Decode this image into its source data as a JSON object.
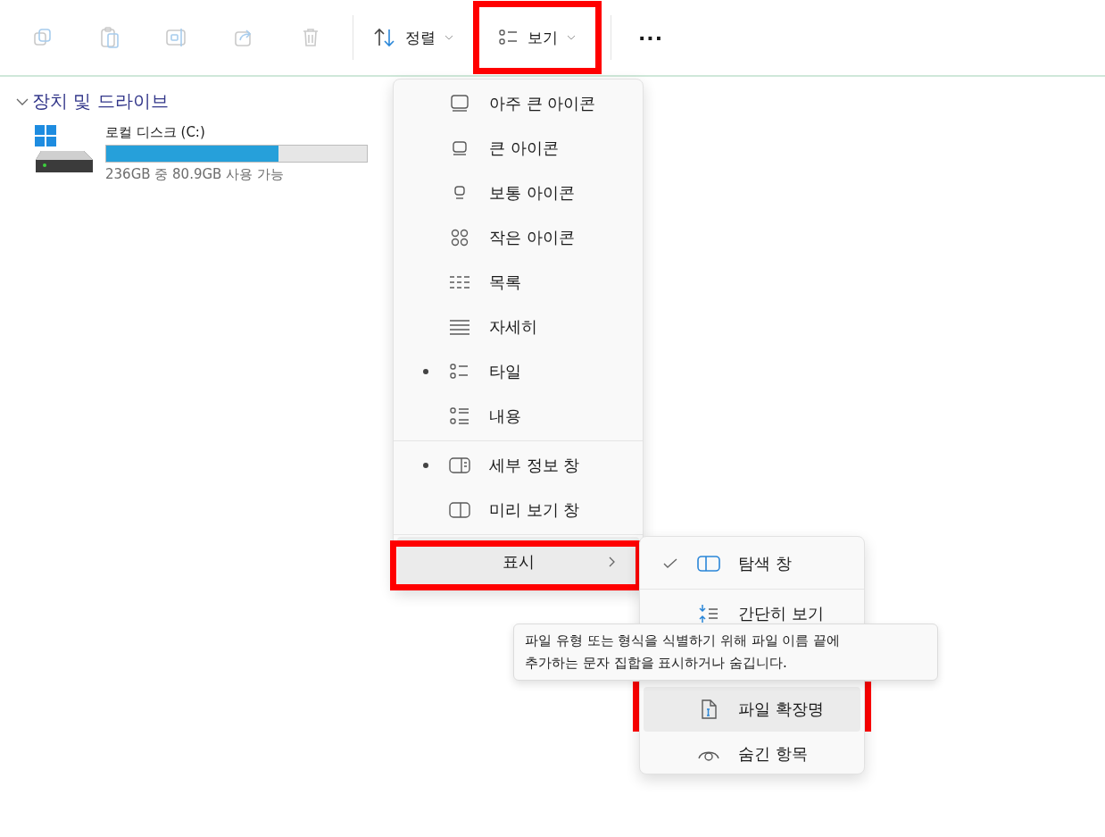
{
  "toolbar": {
    "actions": [
      {
        "kind": "copy",
        "disabled": true
      },
      {
        "kind": "paste",
        "disabled": true
      },
      {
        "kind": "rename",
        "disabled": true
      },
      {
        "kind": "share",
        "disabled": true
      },
      {
        "kind": "delete",
        "disabled": true
      }
    ],
    "sort": {
      "label": "정렬"
    },
    "view": {
      "label": "보기",
      "annotated": true
    },
    "more": {
      "label": "···"
    }
  },
  "section": {
    "title": "장치 및 드라이브",
    "expanded": true
  },
  "drives": [
    {
      "name": "로컬 디스크 (C:)",
      "level": 0.66,
      "reading": "236GB 중 80.9GB 사용 가능"
    }
  ],
  "view_menu": {
    "groups": [
      [
        {
          "kind": "xl-icons",
          "label": "아주 큰 아이콘",
          "selected": false
        },
        {
          "kind": "large-icons",
          "label": "큰 아이콘",
          "selected": false
        },
        {
          "kind": "medium-icons",
          "label": "보통 아이콘",
          "selected": false
        },
        {
          "kind": "small-icons",
          "label": "작은 아이콘",
          "selected": false
        },
        {
          "kind": "list",
          "label": "목록",
          "selected": false
        },
        {
          "kind": "details",
          "label": "자세히",
          "selected": false
        },
        {
          "kind": "tiles",
          "label": "타일",
          "selected": true
        },
        {
          "kind": "content",
          "label": "내용",
          "selected": false
        }
      ],
      [
        {
          "kind": "details-pane",
          "label": "세부 정보 창",
          "selected": true
        },
        {
          "kind": "preview-pane",
          "label": "미리 보기 창",
          "selected": false
        }
      ]
    ],
    "show": {
      "label": "표시",
      "highlighted": true,
      "annotated": true
    }
  },
  "show_submenu": {
    "items": [
      {
        "kind": "nav-pane",
        "label": "탐색 창",
        "checked": true,
        "highlighted": false,
        "annotated": false
      },
      {
        "kind": "compact",
        "label": "간단히 보기",
        "checked": false,
        "highlighted": false,
        "annotated": false
      },
      {
        "kind": "file-ext",
        "label": "파일 확장명",
        "checked": false,
        "highlighted": true,
        "annotated": true
      },
      {
        "kind": "hidden",
        "label": "숨긴 항목",
        "checked": false,
        "highlighted": false,
        "annotated": false
      }
    ]
  },
  "tooltip": {
    "text": "파일 유형 또는 형식을 식별하기 위해 파일 이름 끝에 추가하는 문자 집합을 표시하거나 숨깁니다."
  }
}
